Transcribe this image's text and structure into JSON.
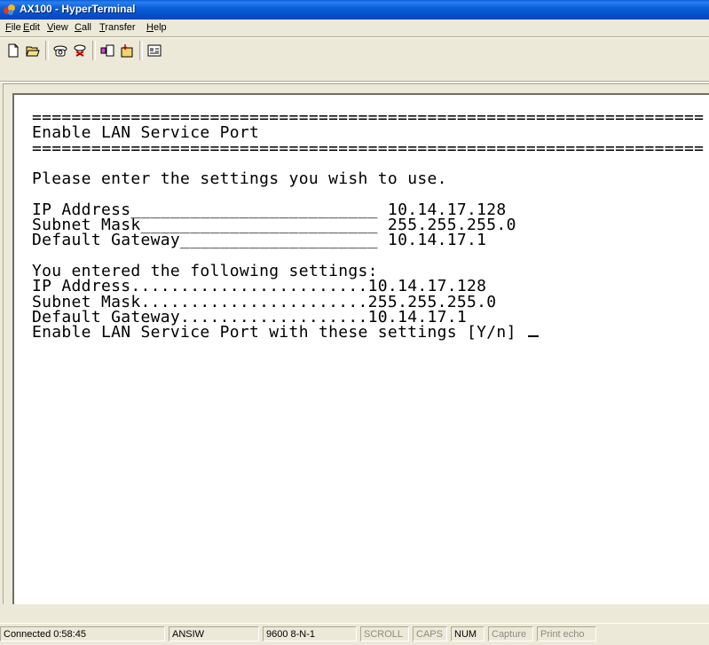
{
  "window": {
    "title": "AX100 - HyperTerminal"
  },
  "menu": [
    {
      "label": "File",
      "underline": "F",
      "rest": "ile"
    },
    {
      "label": "Edit",
      "underline": "E",
      "rest": "dit"
    },
    {
      "label": "View",
      "underline": "V",
      "rest": "iew"
    },
    {
      "label": "Call",
      "underline": "C",
      "rest": "all"
    },
    {
      "label": "Transfer",
      "underline": "T",
      "rest": "ransfer"
    },
    {
      "label": "Help",
      "underline": "H",
      "rest": "elp"
    }
  ],
  "toolbar": {
    "icons": [
      "new-icon",
      "open-icon",
      "connect-icon",
      "disconnect-icon",
      "send-icon",
      "receive-icon",
      "properties-icon"
    ]
  },
  "terminal": {
    "lines": [
      "====================================================================",
      "Enable LAN Service Port",
      "====================================================================",
      "",
      "Please enter the settings you wish to use.",
      "",
      "IP Address_________________________ 10.14.17.128",
      "Subnet Mask________________________ 255.255.255.0",
      "Default Gateway____________________ 10.14.17.1",
      "",
      "You entered the following settings:",
      "IP Address........................10.14.17.128",
      "Subnet Mask.......................255.255.255.0",
      "Default Gateway...................10.14.17.1",
      "Enable LAN Service Port with these settings [Y/n] "
    ]
  },
  "status": {
    "connected": "Connected 0:58:45",
    "emulation": "ANSIW",
    "port": "9600 8-N-1",
    "scroll": "SCROLL",
    "caps": "CAPS",
    "num": "NUM",
    "capture": "Capture",
    "print_echo": "Print echo"
  },
  "colors": {
    "titlebar": "#0a5fd8",
    "face": "#ece9d8",
    "terminal_bg": "#ffffff",
    "dim_text": "#8d8b80"
  }
}
